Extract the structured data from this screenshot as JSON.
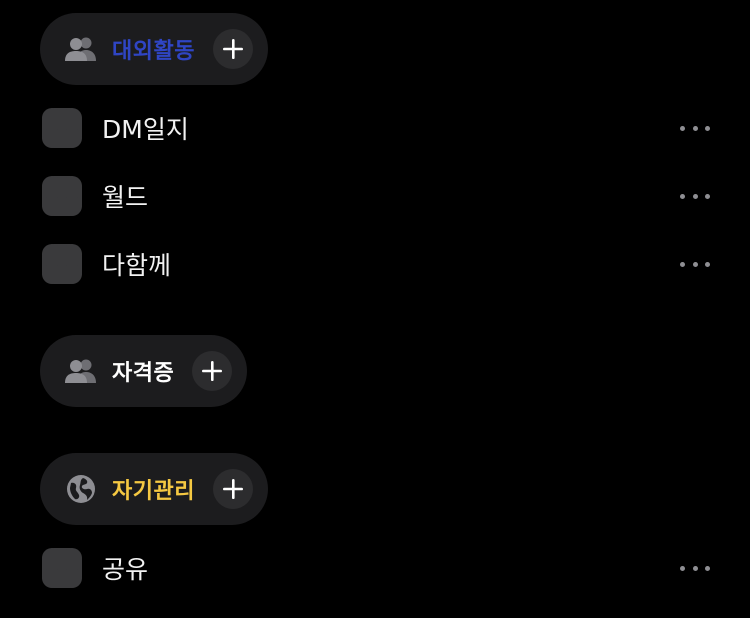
{
  "colors": {
    "background": "#000000",
    "pill_background": "#1c1c1e",
    "add_button_background": "#2c2c2e",
    "icon_gray": "#8e8e93",
    "blob_gray": "#3a3a3c"
  },
  "sections": [
    {
      "label": "대외활동",
      "label_color": "#2f45c4",
      "icon": "people-icon",
      "items": [
        {
          "label": "DM일지"
        },
        {
          "label": "월드"
        },
        {
          "label": "다함께"
        }
      ]
    },
    {
      "label": "자격증",
      "label_color": "#ffffff",
      "icon": "people-icon",
      "items": []
    },
    {
      "label": "자기관리",
      "label_color": "#f5c842",
      "icon": "globe-icon",
      "items": [
        {
          "label": "공유"
        }
      ]
    }
  ]
}
